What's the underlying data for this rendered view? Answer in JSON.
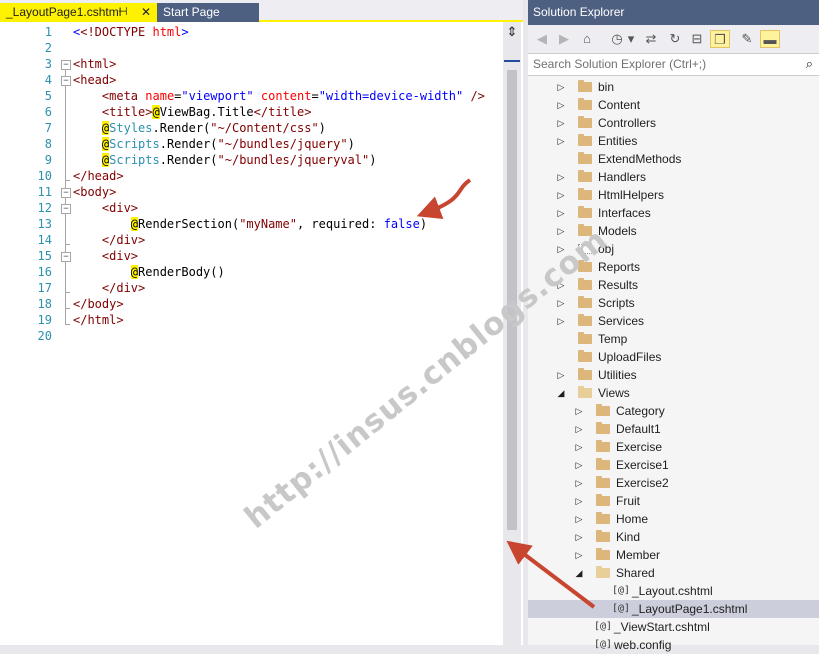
{
  "editor": {
    "tabs": [
      {
        "label": "_LayoutPage1.cshtml",
        "active": true
      },
      {
        "label": "Start Page",
        "active": false
      }
    ],
    "pin_glyph": "⊣",
    "close_glyph": "✕",
    "line_numbers": [
      "1",
      "2",
      "3",
      "4",
      "5",
      "6",
      "7",
      "8",
      "9",
      "10",
      "11",
      "12",
      "13",
      "14",
      "15",
      "16",
      "17",
      "18",
      "19",
      "20"
    ],
    "code": {
      "l1": {
        "a": "<!DOCTYPE ",
        "b": "html",
        "c": ">"
      },
      "l3": "<html>",
      "l4": "<head>",
      "l5": {
        "tag": "<meta",
        "a1": "name",
        "v1": "\"viewport\"",
        "a2": "content",
        "v2": "\"width=device-width\"",
        "end": "/>"
      },
      "l6": {
        "open": "<title>",
        "at": "@",
        "expr": "ViewBag.Title",
        "close": "</title>"
      },
      "l7": {
        "at": "@",
        "obj": "Styles",
        "call": ".Render(",
        "arg": "\"~/Content/css\"",
        "end": ")"
      },
      "l8": {
        "at": "@",
        "obj": "Scripts",
        "call": ".Render(",
        "arg": "\"~/bundles/jquery\"",
        "end": ")"
      },
      "l9": {
        "at": "@",
        "obj": "Scripts",
        "call": ".Render(",
        "arg": "\"~/bundles/jqueryval\"",
        "end": ")"
      },
      "l10": "</head>",
      "l11": "<body>",
      "l12": "<div>",
      "l13": {
        "at": "@",
        "call": "RenderSection(",
        "arg": "\"myName\"",
        "mid": ", required: ",
        "kw": "false",
        "end": ")"
      },
      "l14": "</div>",
      "l15": "<div>",
      "l16": {
        "at": "@",
        "call": "RenderBody()"
      },
      "l17": "</div>",
      "l18": "</body>",
      "l19": "</html>"
    },
    "split_glyph": "⇕",
    "watermark": "http://insus.cnblogs.com"
  },
  "solution_explorer": {
    "title": "Solution Explorer",
    "search_placeholder": "Search Solution Explorer (Ctrl+;)",
    "search_icon": "⌕",
    "toolbar": [
      {
        "icon": "back-icon",
        "glyph": "◀"
      },
      {
        "icon": "forward-icon",
        "glyph": "▶"
      },
      {
        "icon": "home-icon",
        "glyph": "⌂"
      },
      {
        "icon": "history-icon",
        "glyph": "◷"
      },
      {
        "icon": "dropdown-icon",
        "glyph": "▾"
      },
      {
        "icon": "sync-icon",
        "glyph": "⇄"
      },
      {
        "icon": "refresh-icon",
        "glyph": "↻"
      },
      {
        "icon": "collapse-icon",
        "glyph": "⊟"
      },
      {
        "icon": "show-files-icon",
        "glyph": "❐"
      },
      {
        "icon": "properties-icon",
        "glyph": "✎"
      },
      {
        "icon": "preview-icon",
        "glyph": "▬"
      }
    ],
    "items": [
      {
        "label": "bin",
        "depth": 0,
        "type": "folder",
        "exp": "▷"
      },
      {
        "label": "Content",
        "depth": 0,
        "type": "folder",
        "exp": "▷"
      },
      {
        "label": "Controllers",
        "depth": 0,
        "type": "folder",
        "exp": "▷"
      },
      {
        "label": "Entities",
        "depth": 0,
        "type": "folder",
        "exp": "▷"
      },
      {
        "label": "ExtendMethods",
        "depth": 0,
        "type": "folder",
        "exp": ""
      },
      {
        "label": "Handlers",
        "depth": 0,
        "type": "folder",
        "exp": "▷"
      },
      {
        "label": "HtmlHelpers",
        "depth": 0,
        "type": "folder",
        "exp": "▷"
      },
      {
        "label": "Interfaces",
        "depth": 0,
        "type": "folder",
        "exp": "▷"
      },
      {
        "label": "Models",
        "depth": 0,
        "type": "folder",
        "exp": "▷"
      },
      {
        "label": "obj",
        "depth": 0,
        "type": "obj",
        "exp": "▷"
      },
      {
        "label": "Reports",
        "depth": 0,
        "type": "folder",
        "exp": ""
      },
      {
        "label": "Results",
        "depth": 0,
        "type": "folder",
        "exp": "▷"
      },
      {
        "label": "Scripts",
        "depth": 0,
        "type": "folder",
        "exp": "▷"
      },
      {
        "label": "Services",
        "depth": 0,
        "type": "folder",
        "exp": "▷"
      },
      {
        "label": "Temp",
        "depth": 0,
        "type": "folder",
        "exp": ""
      },
      {
        "label": "UploadFiles",
        "depth": 0,
        "type": "folder",
        "exp": ""
      },
      {
        "label": "Utilities",
        "depth": 0,
        "type": "folder",
        "exp": "▷"
      },
      {
        "label": "Views",
        "depth": 0,
        "type": "open",
        "exp": "◢"
      },
      {
        "label": "Category",
        "depth": 1,
        "type": "folder",
        "exp": "▷"
      },
      {
        "label": "Default1",
        "depth": 1,
        "type": "folder",
        "exp": "▷"
      },
      {
        "label": "Exercise",
        "depth": 1,
        "type": "folder",
        "exp": "▷"
      },
      {
        "label": "Exercise1",
        "depth": 1,
        "type": "folder",
        "exp": "▷"
      },
      {
        "label": "Exercise2",
        "depth": 1,
        "type": "folder",
        "exp": "▷"
      },
      {
        "label": "Fruit",
        "depth": 1,
        "type": "folder",
        "exp": "▷"
      },
      {
        "label": "Home",
        "depth": 1,
        "type": "folder",
        "exp": "▷"
      },
      {
        "label": "Kind",
        "depth": 1,
        "type": "folder",
        "exp": "▷"
      },
      {
        "label": "Member",
        "depth": 1,
        "type": "folder",
        "exp": "▷"
      },
      {
        "label": "Shared",
        "depth": 1,
        "type": "open",
        "exp": "◢"
      },
      {
        "label": "_Layout.cshtml",
        "depth": 2,
        "type": "cshtml",
        "exp": ""
      },
      {
        "label": "_LayoutPage1.cshtml",
        "depth": 2,
        "type": "cshtml",
        "exp": "",
        "selected": true
      },
      {
        "label": "_ViewStart.cshtml",
        "depth": 1,
        "type": "cshtml",
        "exp": ""
      },
      {
        "label": "web.config",
        "depth": 1,
        "type": "cshtml",
        "exp": ""
      }
    ],
    "cshtml_glyph": "[@]"
  }
}
